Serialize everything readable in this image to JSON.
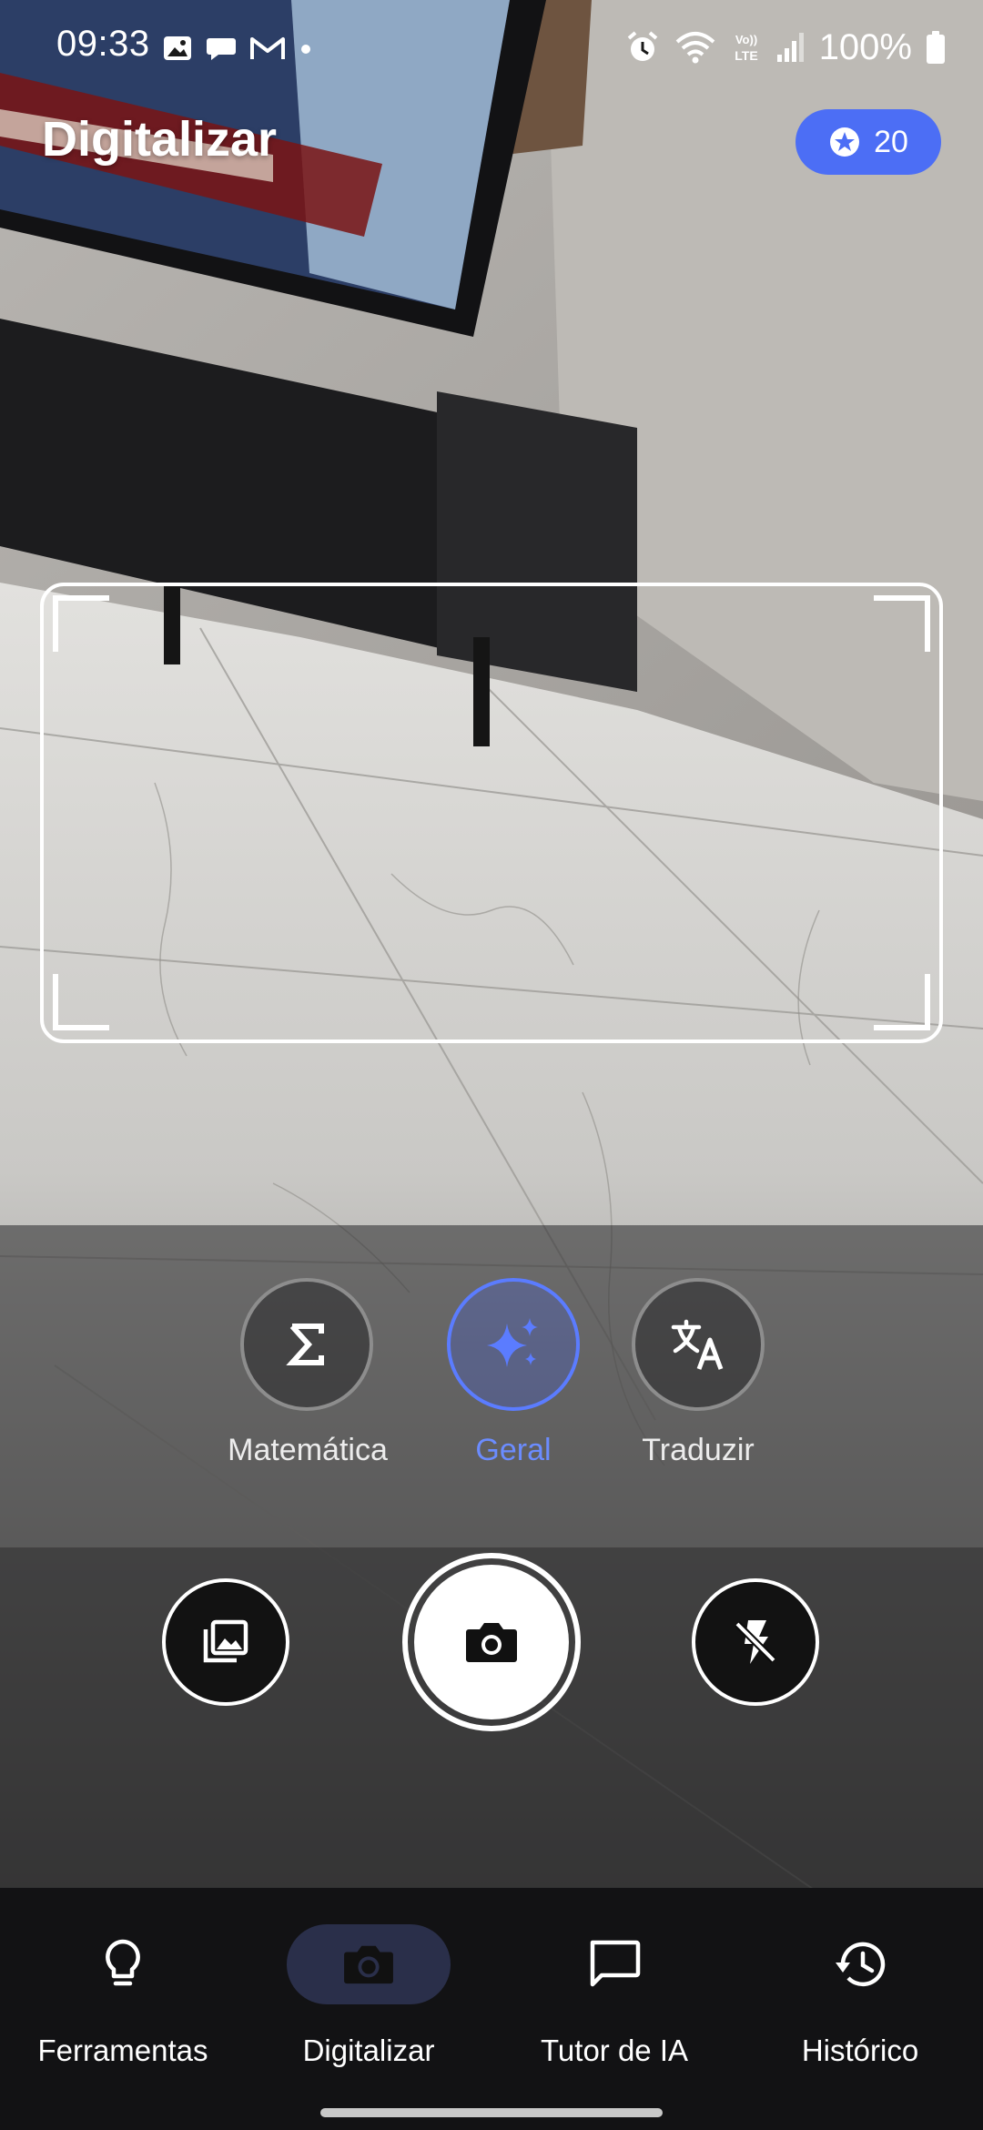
{
  "status_bar": {
    "time": "09:33",
    "battery": "100%",
    "left_icons": [
      "gallery-icon",
      "chat-bubble-icon",
      "gmail-icon",
      "dot-icon"
    ],
    "right_icons": [
      "alarm-icon",
      "wifi-icon",
      "volte-icon",
      "signal-icon",
      "battery-icon"
    ]
  },
  "header": {
    "title": "Digitalizar",
    "credits": "20",
    "credits_icon": "star-badge-icon"
  },
  "modes": [
    {
      "label": "Matemática",
      "icon": "sigma-icon",
      "active": false
    },
    {
      "label": "Geral",
      "icon": "sparkles-icon",
      "active": true
    },
    {
      "label": "Traduzir",
      "icon": "translate-icon",
      "active": false
    }
  ],
  "actions": {
    "gallery_icon": "gallery-stack-icon",
    "shutter_icon": "camera-icon",
    "flash_icon": "flash-off-icon"
  },
  "nav": [
    {
      "label": "Ferramentas",
      "icon": "lightbulb-icon",
      "active": false
    },
    {
      "label": "Digitalizar",
      "icon": "camera-icon",
      "active": true
    },
    {
      "label": "Tutor de IA",
      "icon": "chat-icon",
      "active": false
    },
    {
      "label": "Histórico",
      "icon": "history-icon",
      "active": false
    }
  ],
  "colors": {
    "accent": "#4c6ef5",
    "active_label": "#6b8cff",
    "nav_background": "#121214",
    "nav_active_pill": "#2a2f4a"
  }
}
